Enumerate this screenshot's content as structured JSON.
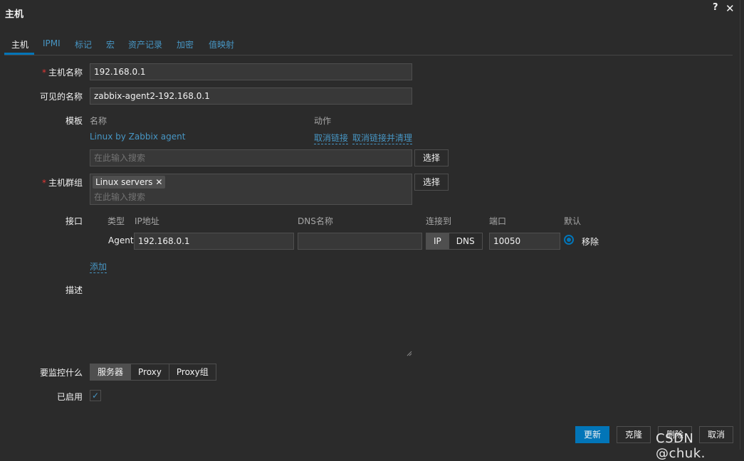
{
  "dialog": {
    "title": "主机",
    "help": "?",
    "close": "✕"
  },
  "tabs": [
    "主机",
    "IPMI",
    "标记",
    "宏",
    "资产记录",
    "加密",
    "值映射"
  ],
  "form": {
    "host_name": {
      "label": "主机名称",
      "required": "*",
      "value": "192.168.0.1"
    },
    "visible_name": {
      "label": "可见的名称",
      "value": "zabbix-agent2-192.168.0.1"
    },
    "templates": {
      "label": "模板",
      "col_name": "名称",
      "col_action": "动作",
      "items": [
        {
          "name": "Linux by Zabbix agent",
          "unlink": "取消链接",
          "unlink_clear": "取消链接并清理"
        }
      ],
      "search_placeholder": "在此输入搜索",
      "select_button": "选择"
    },
    "host_groups": {
      "label": "主机群组",
      "required": "*",
      "chips": [
        "Linux servers"
      ],
      "chip_remove": "✕",
      "search_placeholder": "在此输入搜索",
      "select_button": "选择"
    },
    "interfaces": {
      "label": "接口",
      "headers": {
        "type": "类型",
        "ip": "IP地址",
        "dns": "DNS名称",
        "connect": "连接到",
        "port": "端口",
        "default": "默认"
      },
      "rows": [
        {
          "type": "Agent",
          "ip": "192.168.0.1",
          "dns": "",
          "connect_options": [
            "IP",
            "DNS"
          ],
          "connect_selected": "IP",
          "port": "10050",
          "remove": "移除"
        }
      ],
      "add_link": "添加"
    },
    "description": {
      "label": "描述",
      "value": ""
    },
    "monitored_by": {
      "label": "要监控什么",
      "options": [
        "服务器",
        "Proxy",
        "Proxy组"
      ],
      "selected": "服务器"
    },
    "enabled": {
      "label": "已启用",
      "checked": true,
      "check_glyph": "✓"
    }
  },
  "footer": {
    "update": "更新",
    "clone": "克隆",
    "delete": "删除",
    "cancel": "取消"
  },
  "watermark": "CSDN @chuk.",
  "colors": {
    "accent": "#0275b8",
    "link": "#4796c4",
    "background": "#2b2b2b",
    "required": "#e33734"
  }
}
